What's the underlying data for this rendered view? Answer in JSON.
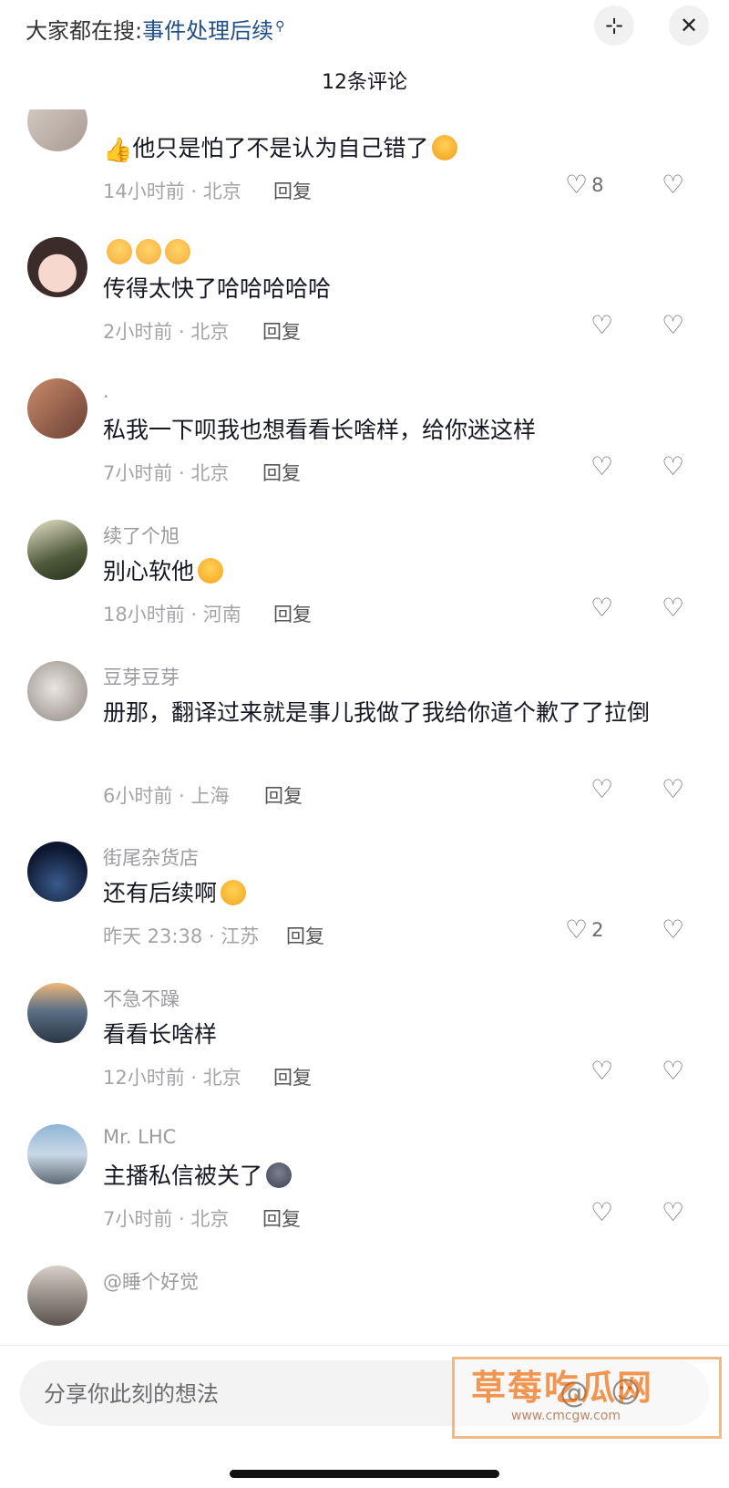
{
  "header": {
    "search_prefix": "大家都在搜:",
    "search_query": "事件处理后续",
    "count_title": "12条评论",
    "collapse_symbol": "⊹",
    "close_symbol": "✕"
  },
  "reply_label": "回复",
  "comments": [
    {
      "name": "",
      "text": "他只是怕了不是认为自己错了",
      "meta": "14小时前 · 北京",
      "likes": "8"
    },
    {
      "name": "",
      "text": "传得太快了哈哈哈哈哈",
      "meta": "2小时前 · 北京",
      "likes": ""
    },
    {
      "name": ".",
      "text": "私我一下呗我也想看看长啥样，给你迷这样",
      "meta": "7小时前 · 北京",
      "likes": ""
    },
    {
      "name": "续了个旭",
      "text": "别心软他",
      "meta": "18小时前 · 河南",
      "likes": ""
    },
    {
      "name": "豆芽豆芽",
      "text": "册那，翻译过来就是事儿我做了我给你道个歉了了拉倒",
      "meta": "6小时前 · 上海",
      "likes": ""
    },
    {
      "name": "街尾杂货店",
      "text": "还有后续啊",
      "meta": "昨天 23:38 · 江苏",
      "likes": "2"
    },
    {
      "name": "不急不躁",
      "text": "看看长啥样",
      "meta": "12小时前 · 北京",
      "likes": ""
    },
    {
      "name": "Mr. LHC",
      "text": "主播私信被关了",
      "meta": "7小时前 · 北京",
      "likes": ""
    },
    {
      "name": "@睡个好觉",
      "text": "",
      "meta": "",
      "likes": ""
    }
  ],
  "footer": {
    "input_placeholder": "分享你此刻的想法",
    "watermark_title": "草莓吃瓜网",
    "watermark_url": "www.cmcgw.com"
  },
  "icons": {
    "like": "heart-outline-icon",
    "dislike": "broken-heart-icon",
    "search": "search-icon",
    "close": "close-icon"
  }
}
